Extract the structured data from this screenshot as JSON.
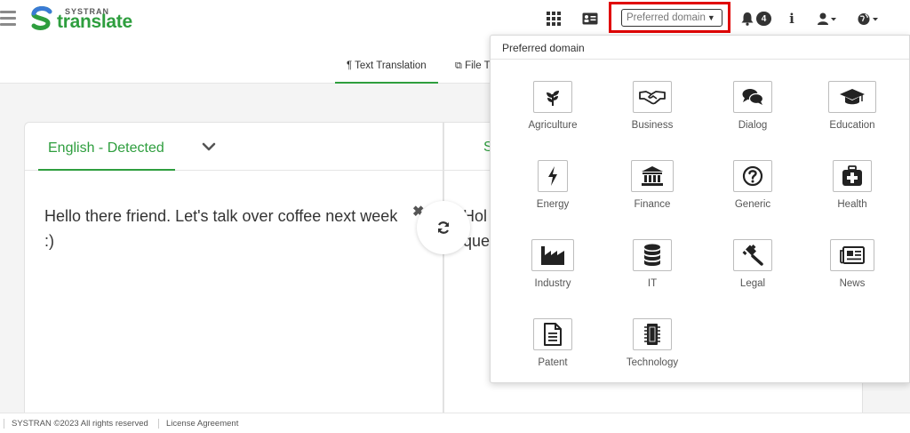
{
  "header": {
    "logo_small": "SYSTRAN",
    "logo_big": "translate",
    "preferred_domain_label": "Preferred domain",
    "notification_count": "4",
    "info_glyph": "i",
    "icons": [
      "menu-icon",
      "apps-grid-icon",
      "contact-card-icon",
      "bell-icon",
      "info-icon",
      "user-icon",
      "globe-icon"
    ]
  },
  "tabs": [
    {
      "label": "¶ Text Translation",
      "active": true
    },
    {
      "label": "File T",
      "active": false
    }
  ],
  "source": {
    "language": "English - Detected",
    "text": "Hello there friend. Let's talk over coffee next week :)",
    "clear_glyph": "✖"
  },
  "target": {
    "language": "S",
    "text_line1": "Hol",
    "text_line2": "que"
  },
  "dropdown": {
    "title": "Preferred domain",
    "domains": [
      {
        "label": "Agriculture",
        "icon": "seedling-icon"
      },
      {
        "label": "Business",
        "icon": "handshake-icon"
      },
      {
        "label": "Dialog",
        "icon": "comments-icon"
      },
      {
        "label": "Education",
        "icon": "graduation-cap-icon"
      },
      {
        "label": "Energy",
        "icon": "lightning-bolt-icon"
      },
      {
        "label": "Finance",
        "icon": "bank-icon"
      },
      {
        "label": "Generic",
        "icon": "question-circle-icon"
      },
      {
        "label": "Health",
        "icon": "medical-kit-icon"
      },
      {
        "label": "Industry",
        "icon": "factory-icon"
      },
      {
        "label": "IT",
        "icon": "database-icon"
      },
      {
        "label": "Legal",
        "icon": "gavel-icon"
      },
      {
        "label": "News",
        "icon": "newspaper-icon"
      },
      {
        "label": "Patent",
        "icon": "document-icon"
      },
      {
        "label": "Technology",
        "icon": "microchip-icon"
      }
    ]
  },
  "footer": {
    "copyright": "SYSTRAN ©2023 All rights reserved",
    "license_link": "License Agreement"
  },
  "colors": {
    "brand_green": "#2e9e3e",
    "highlight_red": "#e00000"
  }
}
